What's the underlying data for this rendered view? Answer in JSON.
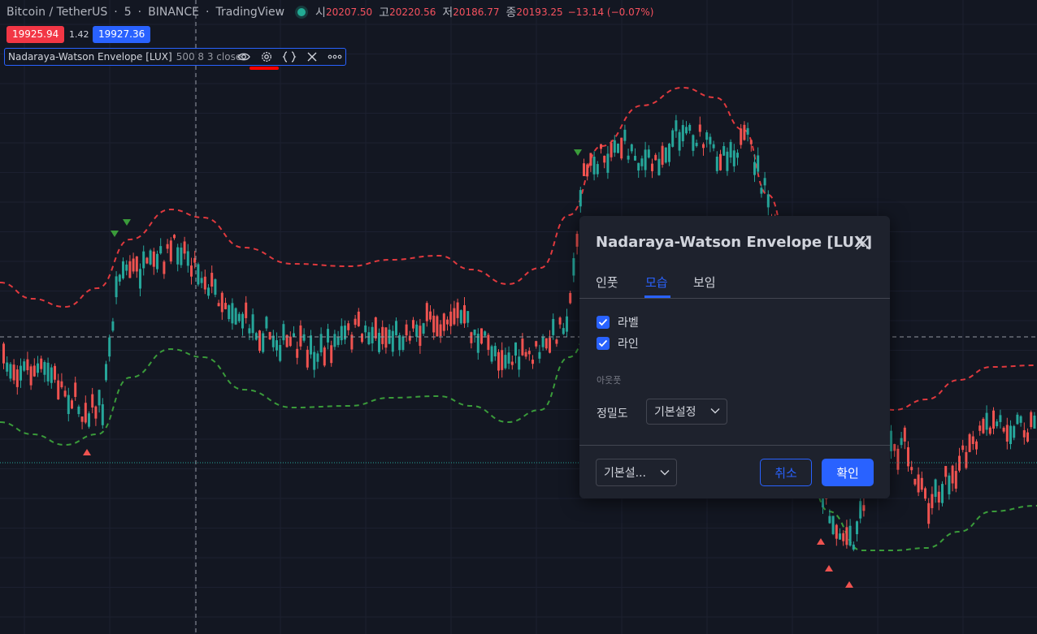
{
  "header": {
    "symbol": "Bitcoin / TetherUS",
    "interval": "5",
    "exchange": "BINANCE",
    "source": "TradingView",
    "ohlc": [
      {
        "label": "시",
        "value": "20207.50"
      },
      {
        "label": "고",
        "value": "20220.56"
      },
      {
        "label": "저",
        "value": "20186.77"
      },
      {
        "label": "종",
        "value": "20193.25"
      }
    ],
    "change": "−13.14 (−0.07%)"
  },
  "prices": {
    "sell": "19925.94",
    "spread": "1.42",
    "buy": "19927.36"
  },
  "indicator": {
    "name": "Nadaraya-Watson Envelope [LUX]",
    "params": "500 8 3 close",
    "icons": [
      "eye-icon",
      "gear-icon",
      "source-code-icon",
      "close-icon",
      "more-icon"
    ]
  },
  "dialog": {
    "title": "Nadaraya-Watson Envelope [LUX]",
    "tabs": [
      {
        "label": "인풋",
        "active": false
      },
      {
        "label": "모습",
        "active": true
      },
      {
        "label": "보임",
        "active": false
      }
    ],
    "checkboxes": [
      {
        "label": "라벨",
        "checked": true
      },
      {
        "label": "라인",
        "checked": true
      }
    ],
    "output_section": "아웃풋",
    "precision_label": "정밀도",
    "precision_value": "기본설정",
    "defaults_label": "기본설...",
    "cancel_label": "취소",
    "ok_label": "확인"
  },
  "colors": {
    "background": "#131722",
    "up": "#26a69a",
    "down": "#ef5350",
    "upper_band": "#e0393e",
    "lower_band": "#3a9b3a",
    "accent": "#2962ff"
  }
}
